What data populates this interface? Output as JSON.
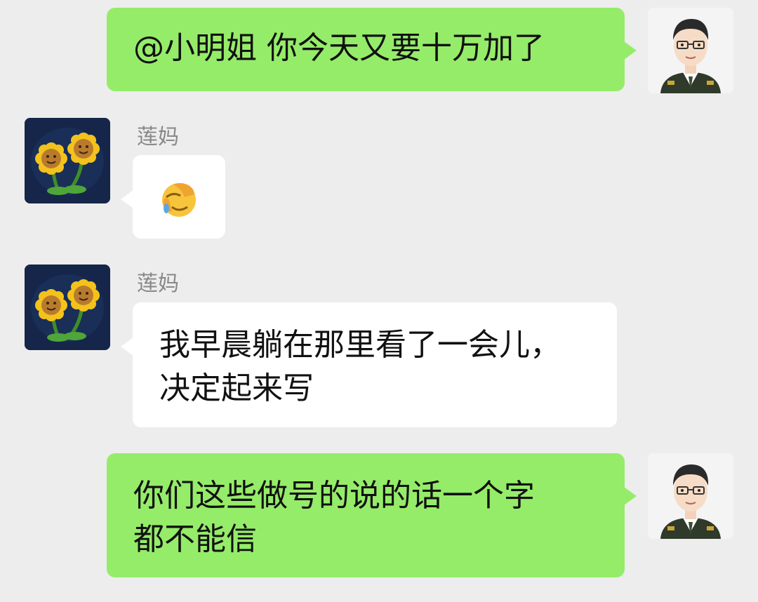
{
  "chat": {
    "messages": [
      {
        "side": "self",
        "text": "@小明姐  你今天又要十万加了",
        "avatar": "cartoon-officer-avatar"
      },
      {
        "side": "other",
        "sender": "莲妈",
        "emoji": "face-palm-laughing-emoji",
        "avatar": "sunflower-avatar"
      },
      {
        "side": "other",
        "sender": "莲妈",
        "text": "我早晨躺在那里看了一会儿，\n决定起来写",
        "avatar": "sunflower-avatar"
      },
      {
        "side": "self",
        "text": "你们这些做号的说的话一个字\n都不能信",
        "avatar": "cartoon-officer-avatar"
      }
    ]
  },
  "colors": {
    "background": "#ededed",
    "self_bubble": "#95ec69",
    "other_bubble": "#ffffff",
    "sender_name": "#888888"
  }
}
